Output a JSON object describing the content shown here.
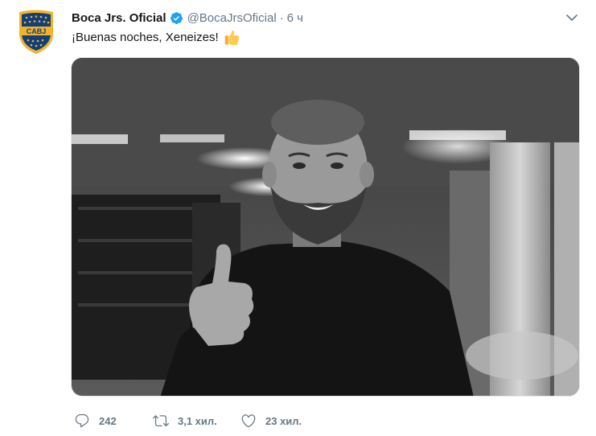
{
  "tweet": {
    "display_name": "Boca Jrs. Oficial",
    "handle": "@BocaJrsOficial",
    "separator": "·",
    "time": "6 ч",
    "text": "¡Buenas noches, Xeneizes!",
    "emoji": "thumbs-up-icon",
    "avatar_text": "CABJ",
    "media": "black-and-white photo of a bearded man in a dark sweater giving a thumbs up",
    "verified": true
  },
  "actions": {
    "reply_count": "242",
    "retweet_count": "3,1 хил.",
    "like_count": "23 хил."
  },
  "colors": {
    "text_primary": "#14171a",
    "text_secondary": "#657786",
    "verified_blue": "#1da1f2",
    "boca_blue": "#103f79",
    "boca_gold": "#f3b229"
  }
}
